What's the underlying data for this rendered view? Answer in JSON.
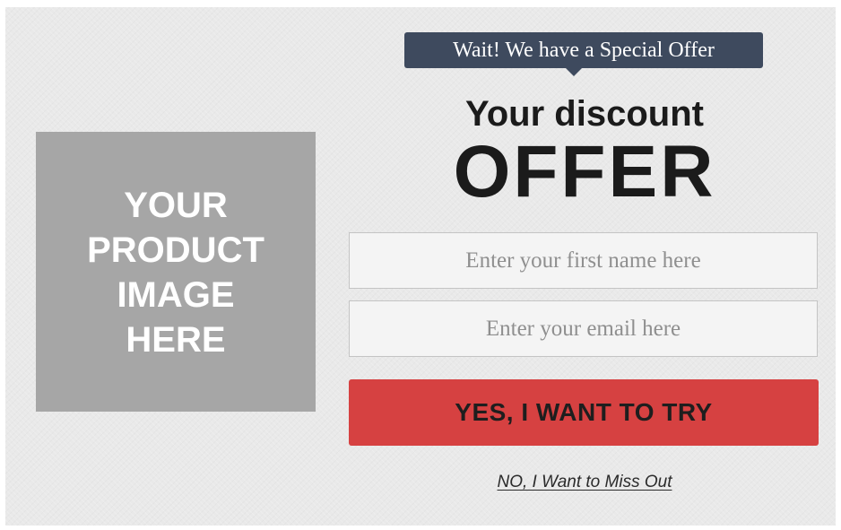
{
  "product_image": {
    "placeholder_text": "YOUR\nPRODUCT\nIMAGE\nHERE"
  },
  "ribbon": {
    "text": "Wait! We have a Special Offer"
  },
  "headline": {
    "line1": "Your discount",
    "line2": "OFFER"
  },
  "form": {
    "first_name": {
      "value": "",
      "placeholder": "Enter your first name here"
    },
    "email": {
      "value": "",
      "placeholder": "Enter your email here"
    },
    "submit_label": "YES, I WANT TO TRY",
    "decline_label": "NO, I Want to Miss Out"
  },
  "colors": {
    "background": "#e9e9e9",
    "ribbon": "#3e4a5e",
    "cta": "#d64141",
    "image_placeholder": "#a6a6a6"
  }
}
